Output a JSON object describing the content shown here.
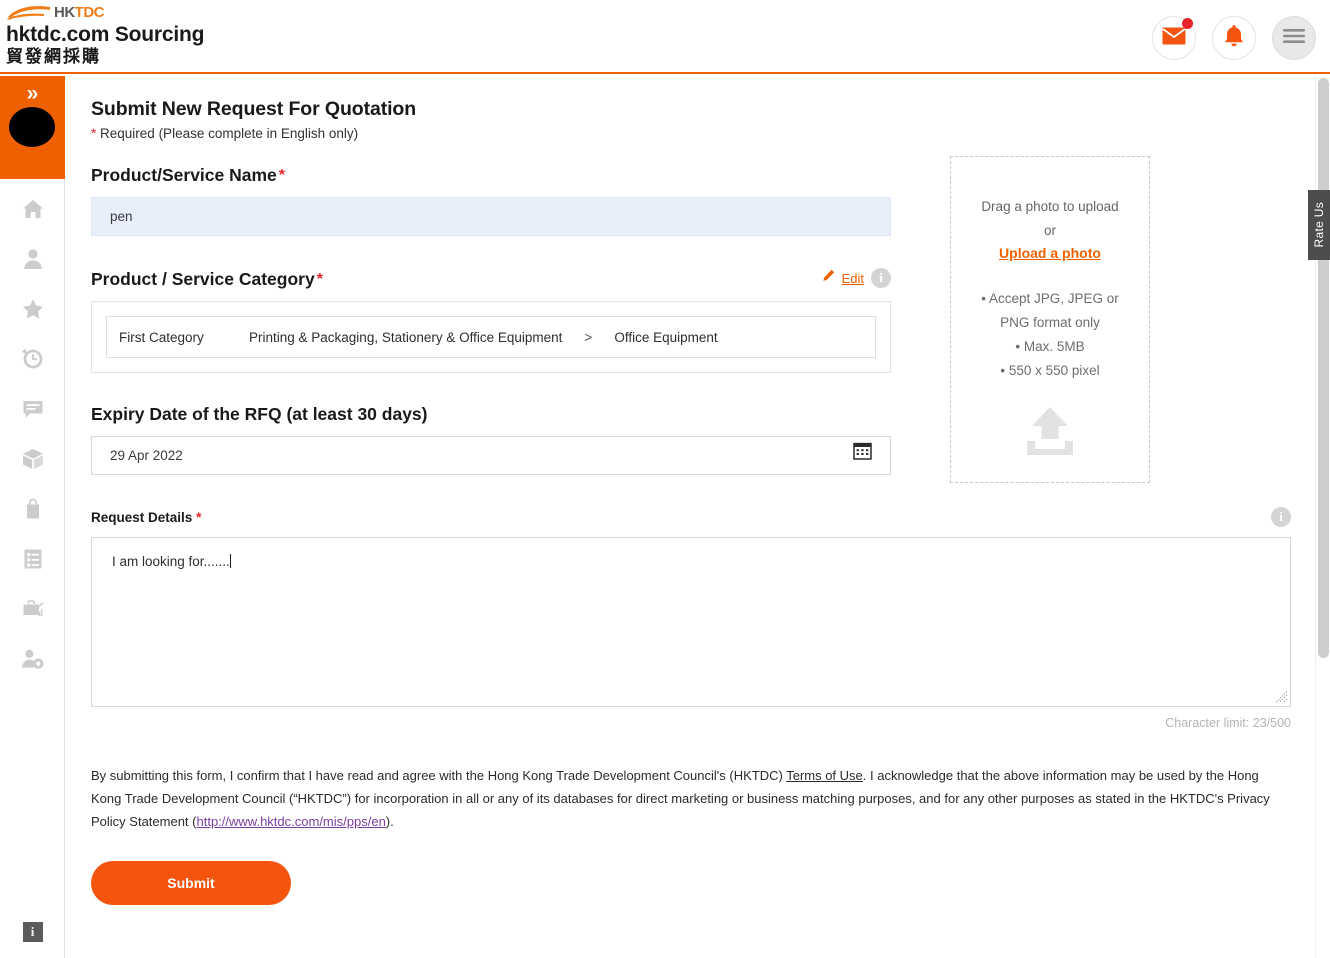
{
  "header": {
    "logo": {
      "hk": "HK",
      "tdc": "TDC",
      "swoosh_color": "#f07d17"
    },
    "brand_title": "hktdc.com Sourcing",
    "brand_title_cn": "貿發網採購",
    "actions": [
      {
        "name": "messages-button",
        "icon": "envelope-icon",
        "has_badge": true
      },
      {
        "name": "notifications-button",
        "icon": "bell-icon",
        "has_badge": false
      },
      {
        "name": "menu-button",
        "icon": "hamburger-icon",
        "has_badge": false
      }
    ],
    "accent_color": "#ef6100"
  },
  "sidebar": {
    "expand_glyph": "»",
    "items": [
      {
        "name": "sidebar-item-home",
        "icon": "home-icon"
      },
      {
        "name": "sidebar-item-profile",
        "icon": "person-icon"
      },
      {
        "name": "sidebar-item-favourites",
        "icon": "star-icon"
      },
      {
        "name": "sidebar-item-history",
        "icon": "history-icon"
      },
      {
        "name": "sidebar-item-messages",
        "icon": "chat-icon"
      },
      {
        "name": "sidebar-item-products",
        "icon": "box-icon"
      },
      {
        "name": "sidebar-item-orders",
        "icon": "bag-icon"
      },
      {
        "name": "sidebar-item-lists",
        "icon": "checklist-icon"
      },
      {
        "name": "sidebar-item-reports",
        "icon": "briefcase-chart-icon"
      },
      {
        "name": "sidebar-item-account-settings",
        "icon": "user-gear-icon"
      }
    ],
    "info_glyph": "i"
  },
  "form": {
    "title": "Submit New Request For Quotation",
    "required_note": "Required (Please complete in English only)",
    "product_name": {
      "label": "Product/Service Name",
      "value": "pen",
      "placeholder": "Product/Service Name"
    },
    "category": {
      "label": "Product / Service Category",
      "edit_label": "Edit",
      "first_label": "First Category",
      "path_primary": "Printing & Packaging, Stationery & Office Equipment",
      "separator": ">",
      "path_secondary": "Office Equipment"
    },
    "expiry": {
      "label": "Expiry Date of the RFQ (at least 30 days)",
      "value": "29 Apr 2022",
      "calendar_icon": "calendar-icon"
    },
    "details": {
      "label": "Request Details",
      "value": "I am looking for.......",
      "placeholder": "Request Details",
      "char_limit": "Character limit: 23/500"
    },
    "submit_label": "Submit",
    "submit_color": "#f4540d"
  },
  "upload": {
    "drag_text": "Drag a photo to upload",
    "or_text": "or",
    "link_text": "Upload a photo",
    "specs": [
      "• Accept JPG, JPEG or",
      "PNG format only",
      "• Max. 5MB",
      "• 550 x 550 pixel"
    ],
    "arrow_icon": "upload-arrow-icon"
  },
  "terms": {
    "part1": "By submitting this form, I confirm that I have read and agree with the Hong Kong Trade Development Council's (HKTDC) ",
    "terms_link": "Terms of Use",
    "part2": ". I acknowledge that the above information may be used by the Hong Kong Trade Development Council (“HKTDC”) for incorporation in all or any of its databases for direct marketing or business matching purposes, and for any other purposes as stated in the HKTDC's Privacy Policy Statement (",
    "url_link": "http://www.hktdc.com/mis/pps/en",
    "part3": ")."
  },
  "rate_us": {
    "label": "Rate Us"
  }
}
